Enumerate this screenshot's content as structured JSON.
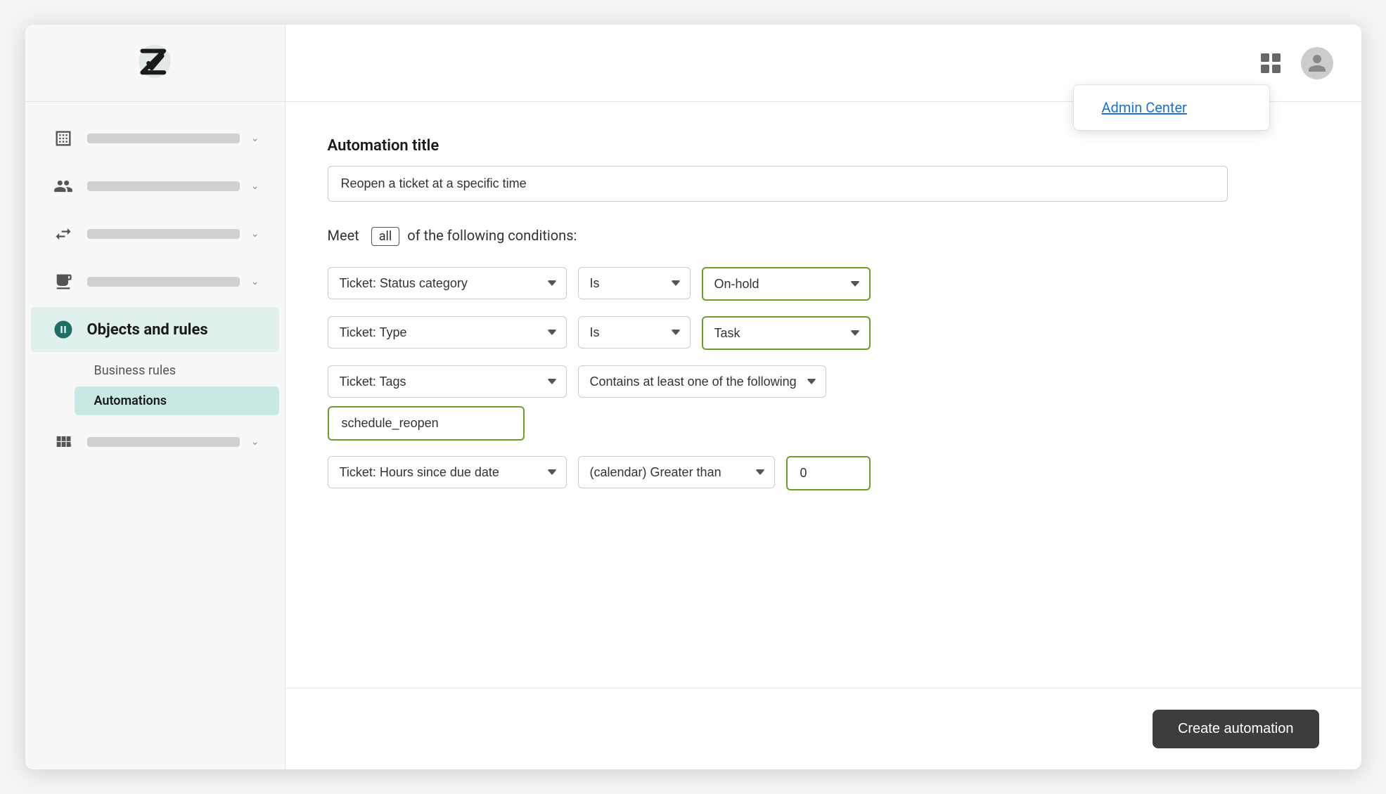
{
  "app": {
    "title": "Zendesk Admin"
  },
  "sidebar": {
    "items": [
      {
        "id": "org",
        "label": "",
        "active": false,
        "icon": "building-icon"
      },
      {
        "id": "people",
        "label": "",
        "active": false,
        "icon": "people-icon"
      },
      {
        "id": "channels",
        "label": "",
        "active": false,
        "icon": "channels-icon"
      },
      {
        "id": "workspace",
        "label": "",
        "active": false,
        "icon": "workspace-icon"
      },
      {
        "id": "objects",
        "label": "Objects and rules",
        "active": true,
        "icon": "objects-icon"
      },
      {
        "id": "apps",
        "label": "",
        "active": false,
        "icon": "apps-icon"
      }
    ],
    "sub_items": [
      {
        "id": "business-rules",
        "label": "Business rules",
        "active": false
      },
      {
        "id": "automations",
        "label": "Automations",
        "active": true
      }
    ]
  },
  "topbar": {
    "admin_center_label": "Admin Center"
  },
  "page": {
    "automation_title_label": "Automation title",
    "automation_title_value": "Reopen a ticket at a specific time",
    "conditions_prefix": "Meet",
    "conditions_all_badge": "all",
    "conditions_suffix": "of the following conditions:",
    "condition_rows": [
      {
        "field": "Ticket: Status category",
        "operator": "Is",
        "value": "On-hold",
        "value_type": "select"
      },
      {
        "field": "Ticket: Type",
        "operator": "Is",
        "value": "Task",
        "value_type": "select"
      },
      {
        "field": "Ticket: Tags",
        "operator": "Contains at least one of the following",
        "value": "schedule_reopen",
        "value_type": "tag_input"
      },
      {
        "field": "Ticket: Hours since due date",
        "operator": "(calendar) Greater than",
        "value": "0",
        "value_type": "number_input"
      }
    ],
    "create_button_label": "Create automation"
  }
}
